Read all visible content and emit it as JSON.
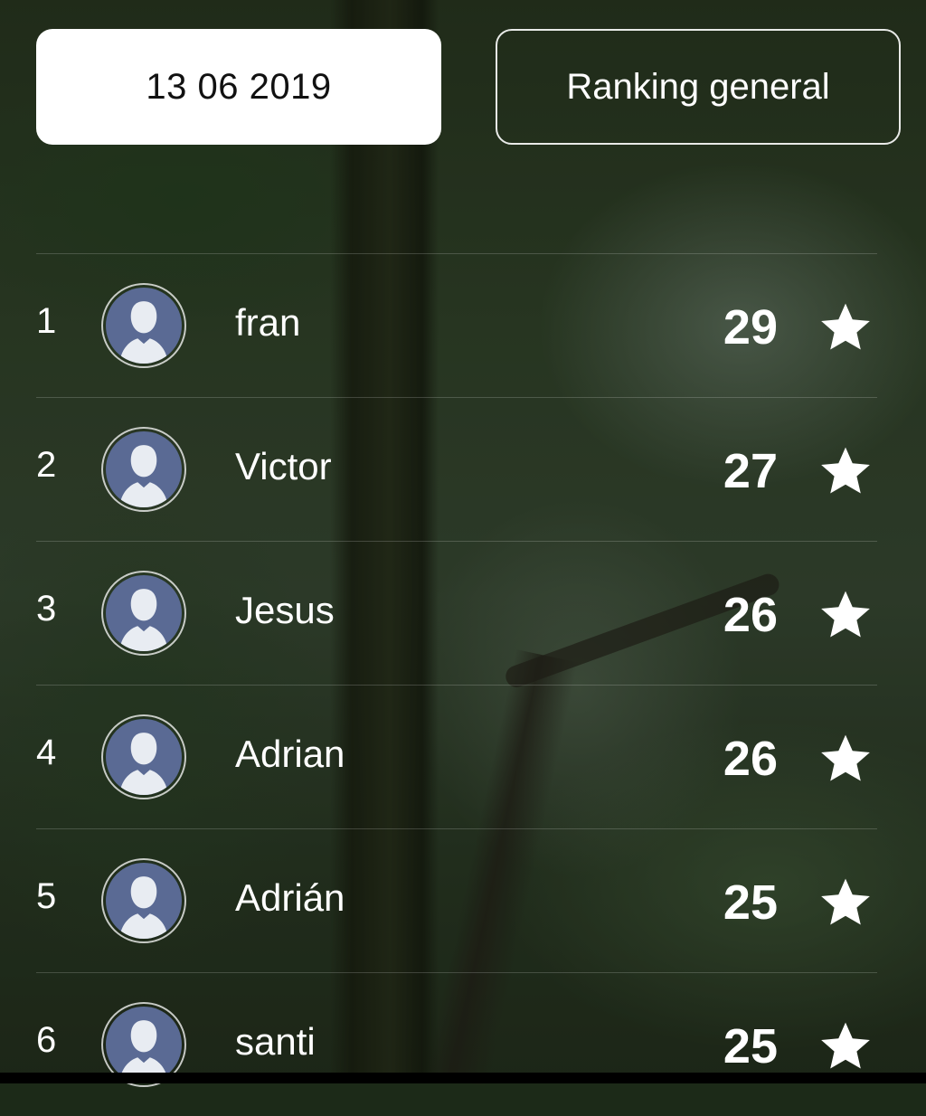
{
  "header": {
    "date": "13 06 2019",
    "ranking_label": "Ranking general"
  },
  "ranking": [
    {
      "position": "1",
      "name": "fran",
      "score": "29"
    },
    {
      "position": "2",
      "name": "Victor",
      "score": "27"
    },
    {
      "position": "3",
      "name": "Jesus",
      "score": "26"
    },
    {
      "position": "4",
      "name": "Adrian",
      "score": "26"
    },
    {
      "position": "5",
      "name": "Adrián",
      "score": "25"
    },
    {
      "position": "6",
      "name": "santi",
      "score": "25"
    }
  ],
  "icons": {
    "avatar": "user-avatar-icon",
    "score": "star-icon"
  },
  "colors": {
    "avatar_bg": "#5a6a94",
    "avatar_figure": "#e8ecf2",
    "button_bg": "#ffffff"
  }
}
